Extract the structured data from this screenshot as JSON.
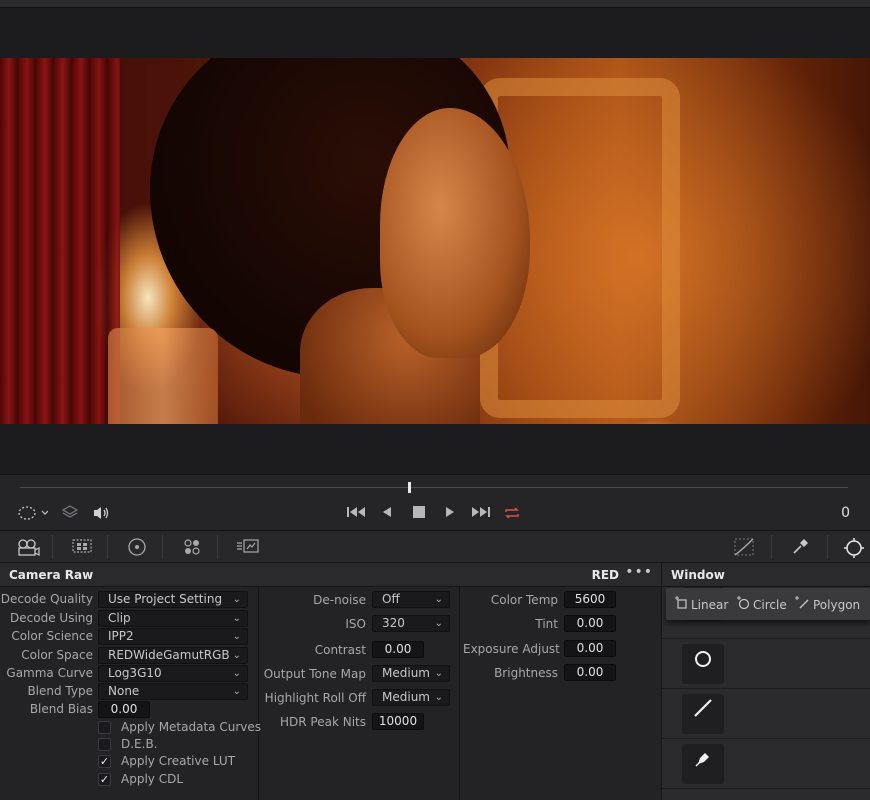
{
  "transport": {
    "frame": "0"
  },
  "camera_raw": {
    "title": "Camera Raw",
    "source": "RED",
    "more": "•••",
    "col1": [
      {
        "label": "Decode Quality",
        "value": "Use Project Setting"
      },
      {
        "label": "Decode Using",
        "value": "Clip"
      },
      {
        "label": "Color Science",
        "value": "IPP2"
      },
      {
        "label": "Color Space",
        "value": "REDWideGamutRGB"
      },
      {
        "label": "Gamma Curve",
        "value": "Log3G10"
      },
      {
        "label": "Blend Type",
        "value": "None"
      }
    ],
    "blend_bias": {
      "label": "Blend Bias",
      "value": "0.00"
    },
    "checkboxes": [
      {
        "label": "Apply Metadata Curves",
        "checked": false
      },
      {
        "label": "D.E.B.",
        "checked": false
      },
      {
        "label": "Apply Creative LUT",
        "checked": true
      },
      {
        "label": "Apply CDL",
        "checked": true
      }
    ],
    "col2": {
      "denoise": {
        "label": "De-noise",
        "value": "Off"
      },
      "iso": {
        "label": "ISO",
        "value": "320"
      },
      "contrast": {
        "label": "Contrast",
        "value": "0.00"
      },
      "tone_map": {
        "label": "Output Tone Map",
        "value": "Medium"
      },
      "roll_off": {
        "label": "Highlight Roll Off",
        "value": "Medium"
      },
      "peak_nits": {
        "label": "HDR Peak Nits",
        "value": "10000"
      }
    },
    "col3": {
      "color_temp": {
        "label": "Color Temp",
        "value": "5600"
      },
      "tint": {
        "label": "Tint",
        "value": "0.00"
      },
      "exposure": {
        "label": "Exposure Adjust",
        "value": "0.00"
      },
      "brightness": {
        "label": "Brightness",
        "value": "0.00"
      }
    }
  },
  "window_panel": {
    "title": "Window",
    "add_linear": "Linear",
    "add_circle": "Circle",
    "add_polygon": "Polygon",
    "check": "✓",
    "shapes": [
      "linear-shape-icon",
      "circle-shape-icon",
      "polygon-shape-icon",
      "curve-shape-icon"
    ]
  },
  "colors": {
    "loop_active": "#e0533a",
    "panel_bg": "#232326",
    "header_bg": "#2a2a2d"
  }
}
